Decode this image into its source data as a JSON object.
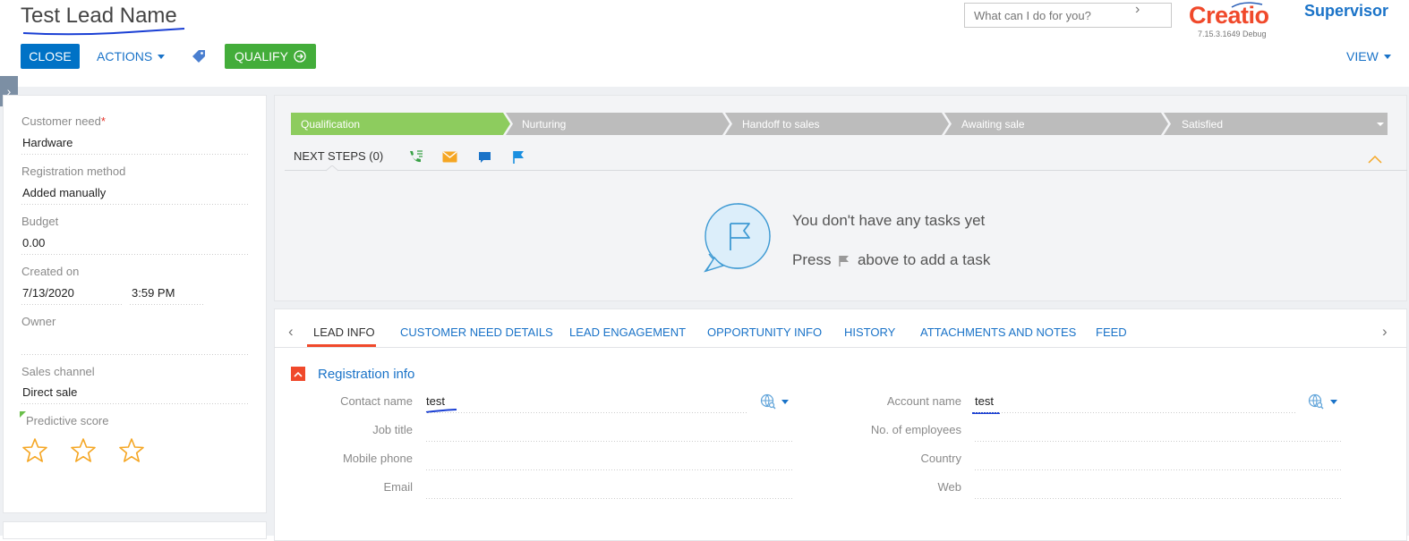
{
  "header": {
    "title": "Test Lead Name",
    "close_label": "CLOSE",
    "actions_label": "ACTIONS",
    "qualify_label": "QUALIFY",
    "search_placeholder": "What can I do for you?",
    "logo_text": "Creatio",
    "version": "7.15.3.1649 Debug",
    "user": "Supervisor",
    "view_label": "VIEW"
  },
  "left_panel": {
    "customer_need": {
      "label": "Customer need",
      "value": "Hardware"
    },
    "registration_method": {
      "label": "Registration method",
      "value": "Added manually"
    },
    "budget": {
      "label": "Budget",
      "value": "0.00"
    },
    "created_on": {
      "label": "Created on",
      "date": "7/13/2020",
      "time": "3:59 PM"
    },
    "owner": {
      "label": "Owner",
      "value": ""
    },
    "sales_channel": {
      "label": "Sales channel",
      "value": "Direct sale"
    },
    "predictive_score": {
      "label": "Predictive score",
      "stars_filled": 0,
      "stars_total": 3
    }
  },
  "stages": [
    "Qualification",
    "Nurturing",
    "Handoff to sales",
    "Awaiting sale",
    "Satisfied"
  ],
  "active_stage": 0,
  "next_steps": {
    "label": "NEXT STEPS (0)",
    "empty_line1": "You don't have any tasks yet",
    "empty_press": "Press",
    "empty_rest": "above to add a task"
  },
  "tabs": [
    "LEAD INFO",
    "CUSTOMER NEED DETAILS",
    "LEAD ENGAGEMENT",
    "OPPORTUNITY INFO",
    "HISTORY",
    "ATTACHMENTS AND NOTES",
    "FEED"
  ],
  "active_tab": 0,
  "registration_info": {
    "title": "Registration info",
    "left": [
      {
        "label": "Contact name",
        "value": "test"
      },
      {
        "label": "Job title",
        "value": ""
      },
      {
        "label": "Mobile phone",
        "value": ""
      },
      {
        "label": "Email",
        "value": ""
      }
    ],
    "right": [
      {
        "label": "Account name",
        "value": "test"
      },
      {
        "label": "No. of employees",
        "value": ""
      },
      {
        "label": "Country",
        "value": ""
      },
      {
        "label": "Web",
        "value": ""
      }
    ]
  },
  "colors": {
    "primary": "#0072c6",
    "success": "#43ad3a",
    "brand": "#f0492b",
    "link": "#1a73c8",
    "stage_active": "#8dcc5e",
    "stage_inactive": "#bcbcbc"
  }
}
